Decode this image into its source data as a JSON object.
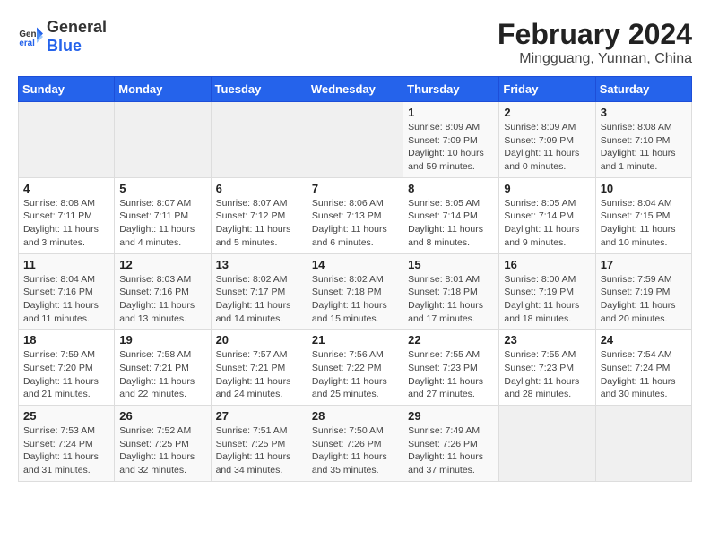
{
  "logo": {
    "general": "General",
    "blue": "Blue"
  },
  "title": "February 2024",
  "subtitle": "Mingguang, Yunnan, China",
  "headers": [
    "Sunday",
    "Monday",
    "Tuesday",
    "Wednesday",
    "Thursday",
    "Friday",
    "Saturday"
  ],
  "weeks": [
    [
      {
        "day": "",
        "info": ""
      },
      {
        "day": "",
        "info": ""
      },
      {
        "day": "",
        "info": ""
      },
      {
        "day": "",
        "info": ""
      },
      {
        "day": "1",
        "info": "Sunrise: 8:09 AM\nSunset: 7:09 PM\nDaylight: 10 hours and 59 minutes."
      },
      {
        "day": "2",
        "info": "Sunrise: 8:09 AM\nSunset: 7:09 PM\nDaylight: 11 hours and 0 minutes."
      },
      {
        "day": "3",
        "info": "Sunrise: 8:08 AM\nSunset: 7:10 PM\nDaylight: 11 hours and 1 minute."
      }
    ],
    [
      {
        "day": "4",
        "info": "Sunrise: 8:08 AM\nSunset: 7:11 PM\nDaylight: 11 hours and 3 minutes."
      },
      {
        "day": "5",
        "info": "Sunrise: 8:07 AM\nSunset: 7:11 PM\nDaylight: 11 hours and 4 minutes."
      },
      {
        "day": "6",
        "info": "Sunrise: 8:07 AM\nSunset: 7:12 PM\nDaylight: 11 hours and 5 minutes."
      },
      {
        "day": "7",
        "info": "Sunrise: 8:06 AM\nSunset: 7:13 PM\nDaylight: 11 hours and 6 minutes."
      },
      {
        "day": "8",
        "info": "Sunrise: 8:05 AM\nSunset: 7:14 PM\nDaylight: 11 hours and 8 minutes."
      },
      {
        "day": "9",
        "info": "Sunrise: 8:05 AM\nSunset: 7:14 PM\nDaylight: 11 hours and 9 minutes."
      },
      {
        "day": "10",
        "info": "Sunrise: 8:04 AM\nSunset: 7:15 PM\nDaylight: 11 hours and 10 minutes."
      }
    ],
    [
      {
        "day": "11",
        "info": "Sunrise: 8:04 AM\nSunset: 7:16 PM\nDaylight: 11 hours and 11 minutes."
      },
      {
        "day": "12",
        "info": "Sunrise: 8:03 AM\nSunset: 7:16 PM\nDaylight: 11 hours and 13 minutes."
      },
      {
        "day": "13",
        "info": "Sunrise: 8:02 AM\nSunset: 7:17 PM\nDaylight: 11 hours and 14 minutes."
      },
      {
        "day": "14",
        "info": "Sunrise: 8:02 AM\nSunset: 7:18 PM\nDaylight: 11 hours and 15 minutes."
      },
      {
        "day": "15",
        "info": "Sunrise: 8:01 AM\nSunset: 7:18 PM\nDaylight: 11 hours and 17 minutes."
      },
      {
        "day": "16",
        "info": "Sunrise: 8:00 AM\nSunset: 7:19 PM\nDaylight: 11 hours and 18 minutes."
      },
      {
        "day": "17",
        "info": "Sunrise: 7:59 AM\nSunset: 7:19 PM\nDaylight: 11 hours and 20 minutes."
      }
    ],
    [
      {
        "day": "18",
        "info": "Sunrise: 7:59 AM\nSunset: 7:20 PM\nDaylight: 11 hours and 21 minutes."
      },
      {
        "day": "19",
        "info": "Sunrise: 7:58 AM\nSunset: 7:21 PM\nDaylight: 11 hours and 22 minutes."
      },
      {
        "day": "20",
        "info": "Sunrise: 7:57 AM\nSunset: 7:21 PM\nDaylight: 11 hours and 24 minutes."
      },
      {
        "day": "21",
        "info": "Sunrise: 7:56 AM\nSunset: 7:22 PM\nDaylight: 11 hours and 25 minutes."
      },
      {
        "day": "22",
        "info": "Sunrise: 7:55 AM\nSunset: 7:23 PM\nDaylight: 11 hours and 27 minutes."
      },
      {
        "day": "23",
        "info": "Sunrise: 7:55 AM\nSunset: 7:23 PM\nDaylight: 11 hours and 28 minutes."
      },
      {
        "day": "24",
        "info": "Sunrise: 7:54 AM\nSunset: 7:24 PM\nDaylight: 11 hours and 30 minutes."
      }
    ],
    [
      {
        "day": "25",
        "info": "Sunrise: 7:53 AM\nSunset: 7:24 PM\nDaylight: 11 hours and 31 minutes."
      },
      {
        "day": "26",
        "info": "Sunrise: 7:52 AM\nSunset: 7:25 PM\nDaylight: 11 hours and 32 minutes."
      },
      {
        "day": "27",
        "info": "Sunrise: 7:51 AM\nSunset: 7:25 PM\nDaylight: 11 hours and 34 minutes."
      },
      {
        "day": "28",
        "info": "Sunrise: 7:50 AM\nSunset: 7:26 PM\nDaylight: 11 hours and 35 minutes."
      },
      {
        "day": "29",
        "info": "Sunrise: 7:49 AM\nSunset: 7:26 PM\nDaylight: 11 hours and 37 minutes."
      },
      {
        "day": "",
        "info": ""
      },
      {
        "day": "",
        "info": ""
      }
    ]
  ]
}
